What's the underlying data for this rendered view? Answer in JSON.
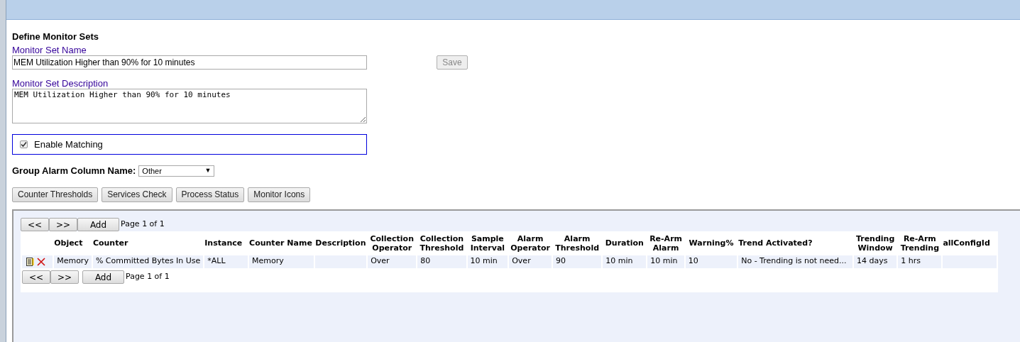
{
  "form": {
    "title": "Define Monitor Sets",
    "name_label": "Monitor Set Name",
    "name_value": "MEM Utilization Higher than 90% for 10 minutes",
    "save": {
      "label": "Save",
      "disabled": true
    },
    "description_label": "Monitor Set Description",
    "description_value": "MEM Utilization Higher than 90% for 10 minutes",
    "enable_matching": {
      "label": "Enable Matching",
      "checked": true
    },
    "group_alarm": {
      "label": "Group Alarm Column Name:",
      "value": "Other",
      "arrow": "▼"
    },
    "tabs": [
      {
        "label": "Counter Thresholds"
      },
      {
        "label": "Services Check"
      },
      {
        "label": "Process Status"
      },
      {
        "label": "Monitor Icons"
      }
    ]
  },
  "grid": {
    "top_pager": {
      "prev": "<<",
      "next": ">>",
      "add": "Add",
      "page": "Page 1 of 1"
    },
    "columns": [
      "Object",
      "Counter",
      "Instance",
      "Counter Name",
      "Description",
      "Collection Operator",
      "Collection Threshold",
      "Sample Interval",
      "Alarm Operator",
      "Alarm Threshold",
      "Duration",
      "Re-Arm Alarm",
      "Warning%",
      "Trend Activated?",
      "Trending Window",
      "Re-Arm Trending",
      "allConfigId"
    ],
    "rows": [
      {
        "cells": [
          "Memory",
          "% Committed Bytes In Use",
          "*ALL",
          "Memory",
          "",
          "Over",
          "80",
          "10 min",
          "Over",
          "90",
          "10 min",
          "10 min",
          "10",
          "No - Trending is not need...",
          "14 days",
          "1 hrs",
          ""
        ]
      }
    ],
    "bottom_pager": {
      "prev": "<<",
      "next": ">>",
      "add": "Add",
      "page": "Page 1 of 1"
    }
  }
}
